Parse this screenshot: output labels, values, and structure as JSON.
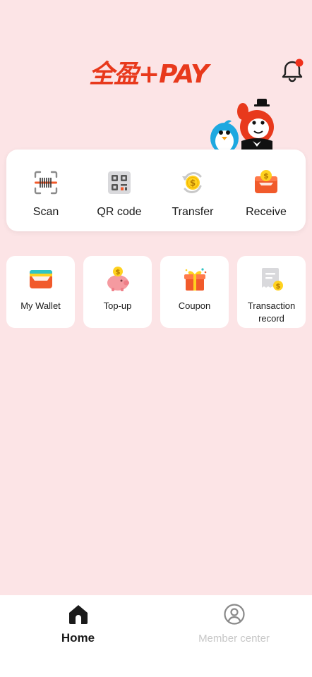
{
  "header": {
    "logo_text": "全盈+PAY",
    "brand_color": "#e8391c",
    "notification_dot": true
  },
  "quick_actions": [
    {
      "label": "Scan",
      "icon": "scan-icon"
    },
    {
      "label": "QR code",
      "icon": "qr-code-icon"
    },
    {
      "label": "Transfer",
      "icon": "transfer-icon"
    },
    {
      "label": "Receive",
      "icon": "receive-icon"
    }
  ],
  "tiles": [
    {
      "label": "My Wallet",
      "icon": "wallet-icon"
    },
    {
      "label": "Top-up",
      "icon": "piggy-bank-icon"
    },
    {
      "label": "Coupon",
      "icon": "gift-icon"
    },
    {
      "label": "Transaction record",
      "icon": "receipt-icon"
    }
  ],
  "bottom_nav": [
    {
      "label": "Home",
      "icon": "home-icon",
      "active": true
    },
    {
      "label": "Member center",
      "icon": "user-circle-icon",
      "active": false
    }
  ],
  "colors": {
    "background": "#fce4e6",
    "accent_orange": "#f15a2b",
    "coin_yellow": "#ffd21f"
  }
}
